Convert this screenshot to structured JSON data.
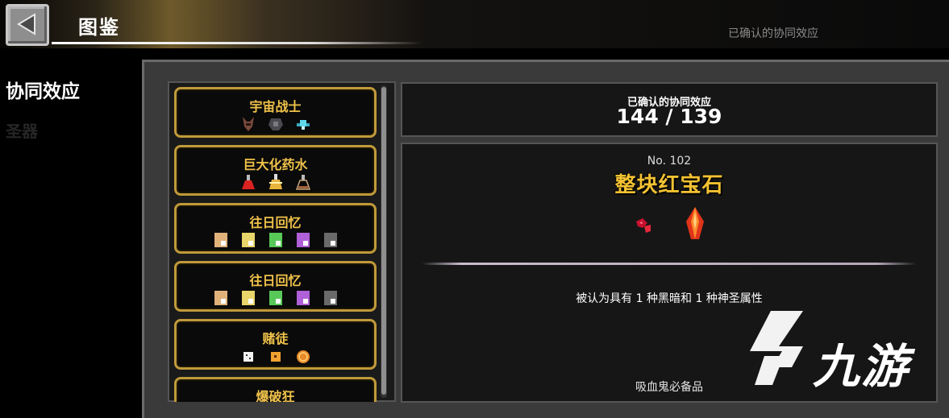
{
  "header": {
    "title": "图鉴"
  },
  "sidebar": {
    "category": "协同效应",
    "second": "圣器"
  },
  "background_ghost": {
    "confirmed_label": "已确认的协同效应"
  },
  "synergy_list": [
    {
      "name": "宇宙战士",
      "icons": [
        "demon-helmet-icon",
        "dark-armor-icon",
        "cyan-spaceship-icon"
      ]
    },
    {
      "name": "巨大化药水",
      "icons": [
        "red-potion-icon",
        "yellow-potion-icon",
        "empty-flask-icon"
      ]
    },
    {
      "name": "往日回忆",
      "icons": [
        "tan-memory-card-icon",
        "yellow-memory-card-icon",
        "green-memory-card-icon",
        "purple-memory-card-icon",
        "gray-memory-card-icon"
      ]
    },
    {
      "name": "往日回忆",
      "icons": [
        "tan-memory-card-icon",
        "yellow-memory-card-icon",
        "green-memory-card-icon",
        "purple-memory-card-icon",
        "gray-memory-card-icon"
      ]
    },
    {
      "name": "赌徒",
      "icons": [
        "white-dice-icon",
        "orange-dice-icon",
        "gold-coin-icon"
      ]
    },
    {
      "name": "爆破狂",
      "icons": []
    }
  ],
  "summary": {
    "label": "已确认的协同效应",
    "count": "144 / 139"
  },
  "detail": {
    "number": "No. 102",
    "name": "整块红宝石",
    "icons": [
      "red-gem-shards-icon",
      "ruby-crystal-icon"
    ],
    "description": "被认为具有 1 种黑暗和 1 种神圣属性",
    "note": "吸血鬼必备品"
  },
  "watermark": {
    "text": "九游"
  },
  "colors": {
    "gold": "#f4c232",
    "card_border": "#c09a3a",
    "panel": "#3a3a3a"
  }
}
